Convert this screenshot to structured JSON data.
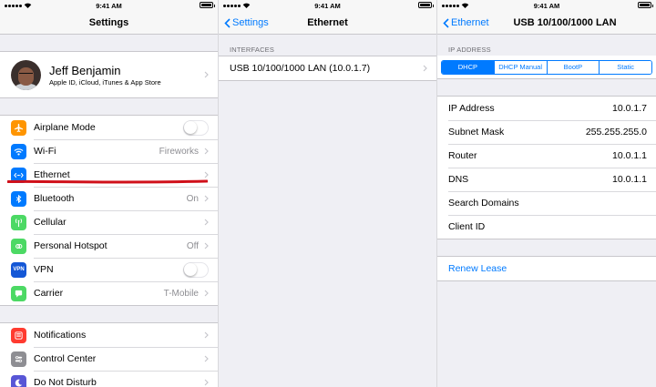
{
  "status_bar": {
    "time": "9:41 AM"
  },
  "colors": {
    "accent": "#007aff",
    "annotation": "#d0101a",
    "airplane": "#ff9500",
    "wifi": "#007aff",
    "ethernet": "#007aff",
    "bluetooth": "#007aff",
    "cellular": "#4cd964",
    "hotspot": "#4cd964",
    "vpn": "#1457d6",
    "carrier": "#4cd964",
    "notifications": "#ff3b30",
    "control_center": "#8e8e93",
    "do_not_disturb": "#5856d6"
  },
  "settings_screen": {
    "title": "Settings",
    "profile": {
      "name": "Jeff Benjamin",
      "subtitle": "Apple ID, iCloud, iTunes & App Store"
    },
    "network_rows": [
      {
        "label": "Airplane Mode",
        "icon": "airplane-icon",
        "value": "",
        "control": "toggle",
        "toggle_on": false
      },
      {
        "label": "Wi-Fi",
        "icon": "wifi-icon",
        "value": "Fireworks",
        "control": "chevron"
      },
      {
        "label": "Ethernet",
        "icon": "ethernet-icon",
        "value": "",
        "control": "chevron"
      },
      {
        "label": "Bluetooth",
        "icon": "bluetooth-icon",
        "value": "On",
        "control": "chevron"
      },
      {
        "label": "Cellular",
        "icon": "cellular-icon",
        "value": "",
        "control": "chevron"
      },
      {
        "label": "Personal Hotspot",
        "icon": "hotspot-icon",
        "value": "Off",
        "control": "chevron"
      },
      {
        "label": "VPN",
        "icon": "vpn-icon",
        "icon_text": "VPN",
        "value": "",
        "control": "toggle",
        "toggle_on": false
      },
      {
        "label": "Carrier",
        "icon": "carrier-icon",
        "value": "T-Mobile",
        "control": "chevron"
      }
    ],
    "system_rows": [
      {
        "label": "Notifications",
        "icon": "notifications-icon"
      },
      {
        "label": "Control Center",
        "icon": "control-center-icon"
      },
      {
        "label": "Do Not Disturb",
        "icon": "moon-icon"
      }
    ]
  },
  "ethernet_screen": {
    "back_label": "Settings",
    "title": "Ethernet",
    "section_header": "INTERFACES",
    "interface_label": "USB 10/100/1000 LAN (10.0.1.7)"
  },
  "lan_screen": {
    "back_label": "Ethernet",
    "title": "USB 10/100/1000 LAN",
    "section_header": "IP ADDRESS",
    "segments": [
      "DHCP",
      "DHCP Manual",
      "BootP",
      "Static"
    ],
    "selected_segment": "DHCP",
    "fields": [
      {
        "label": "IP Address",
        "value": "10.0.1.7"
      },
      {
        "label": "Subnet Mask",
        "value": "255.255.255.0"
      },
      {
        "label": "Router",
        "value": "10.0.1.1"
      },
      {
        "label": "DNS",
        "value": "10.0.1.1"
      },
      {
        "label": "Search Domains",
        "value": ""
      },
      {
        "label": "Client ID",
        "value": ""
      }
    ],
    "renew_label": "Renew Lease"
  }
}
